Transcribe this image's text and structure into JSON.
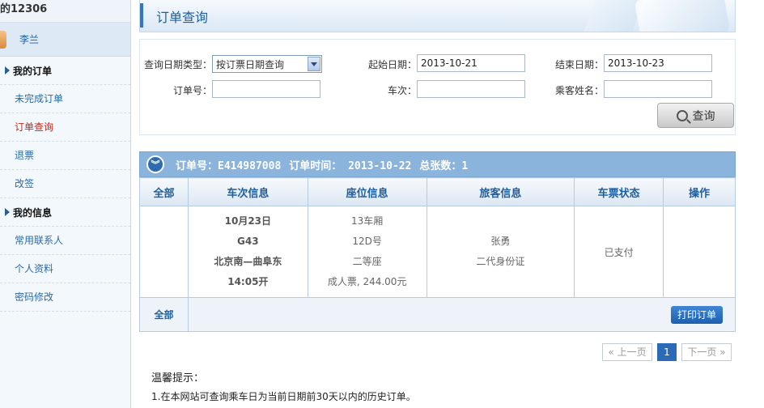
{
  "sidebar": {
    "brand": "的12306",
    "user_name": "李兰",
    "sections": [
      {
        "title": "我的订单",
        "items": [
          "未完成订单",
          "订单查询",
          "退票",
          "改签"
        ]
      },
      {
        "title": "我的信息",
        "items": [
          "常用联系人",
          "个人资料",
          "密码修改"
        ]
      }
    ]
  },
  "header": {
    "title": "订单查询"
  },
  "search": {
    "date_type_label": "查询日期类型：",
    "date_type_value": "按订票日期查询",
    "start_label": "起始日期：",
    "start_value": "2013-10-21",
    "end_label": "结束日期：",
    "end_value": "2013-10-23",
    "order_no_label": "订单号：",
    "train_label": "车次：",
    "passenger_label": "乘客姓名：",
    "search_button": "查询"
  },
  "order": {
    "order_no": "订单号：E414987008",
    "order_time": "订单时间： 2013-10-22",
    "ticket_count": "总张数：1"
  },
  "table": {
    "headers": [
      "全部",
      "车次信息",
      "座位信息",
      "旅客信息",
      "车票状态",
      "操作"
    ],
    "row": {
      "train": [
        "10月23日",
        "G43",
        "北京南—曲阜东",
        "14:05开"
      ],
      "seat": [
        "13车厢",
        "12D号",
        "二等座",
        "成人票, 244.00元"
      ],
      "passenger": [
        "张勇",
        "二代身份证"
      ],
      "status": "已支付"
    },
    "footer_label": "全部",
    "print_button": "打印订单"
  },
  "pager": {
    "prev": "« 上一页",
    "current": "1",
    "next": "下一页 »"
  },
  "tips": {
    "title": "温馨提示：",
    "items": [
      "1.在本网站可查询乘车日为当前日期前30天以内的历史订单。"
    ]
  },
  "colors": {
    "accent": "#2b6ab7",
    "order_bar": "#8bb4dc",
    "active_nav": "#c0281b"
  }
}
